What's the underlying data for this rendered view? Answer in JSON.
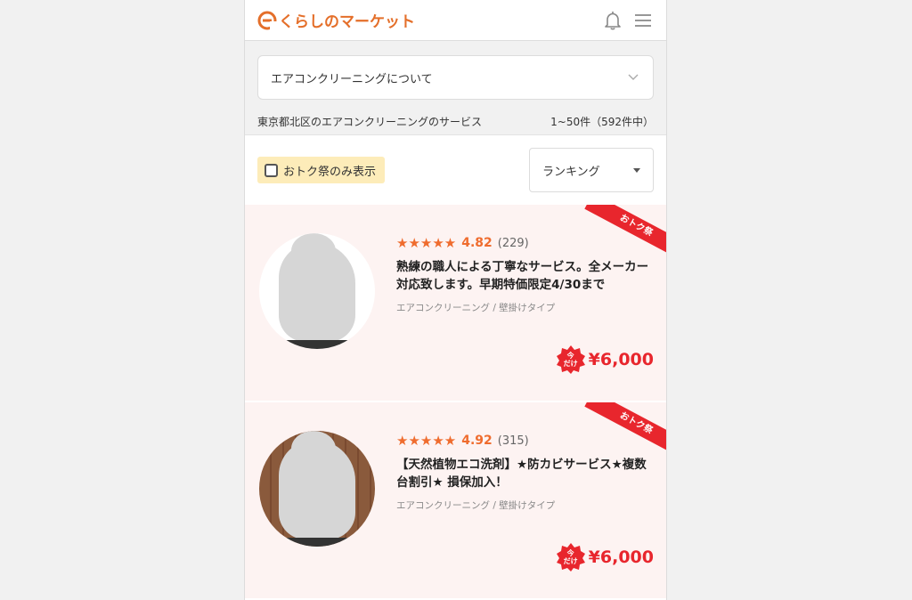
{
  "header": {
    "logo_text": "くらしのマーケット",
    "brand_color": "#e46f2a"
  },
  "category_select": {
    "label": "エアコンクリーニングについて"
  },
  "listing_meta": {
    "context": "東京都北区のエアコンクリーニングのサービス",
    "range": "1~50件（592件中）"
  },
  "filters": {
    "otoku_label": "おトク祭のみ表示",
    "otoku_checked": false,
    "sort_label": "ランキング"
  },
  "listings": [
    {
      "ribbon": "おトク祭",
      "stars_display": "★★★★★",
      "rating": "4.82",
      "reviews": "(229)",
      "title": "熟練の職人による丁寧なサービス。全メーカー対応致します。早期特価限定4/30まで",
      "category": "エアコンクリーニング / 壁掛けタイプ",
      "badge_line1": "今",
      "badge_line2": "だけ",
      "price": "¥6,000"
    },
    {
      "ribbon": "おトク祭",
      "stars_display": "★★★★★",
      "rating": "4.92",
      "reviews": "(315)",
      "title": "【天然植物エコ洗剤】★防カビサービス★複数台割引★ 損保加入！",
      "category": "エアコンクリーニング / 壁掛けタイプ",
      "badge_line1": "今",
      "badge_line2": "だけ",
      "price": "¥6,000"
    }
  ],
  "colors": {
    "accent": "#ef6c2e",
    "sale_red": "#e8262d",
    "card_bg": "#fdf3f2",
    "filter_bg": "#fdecb9"
  }
}
